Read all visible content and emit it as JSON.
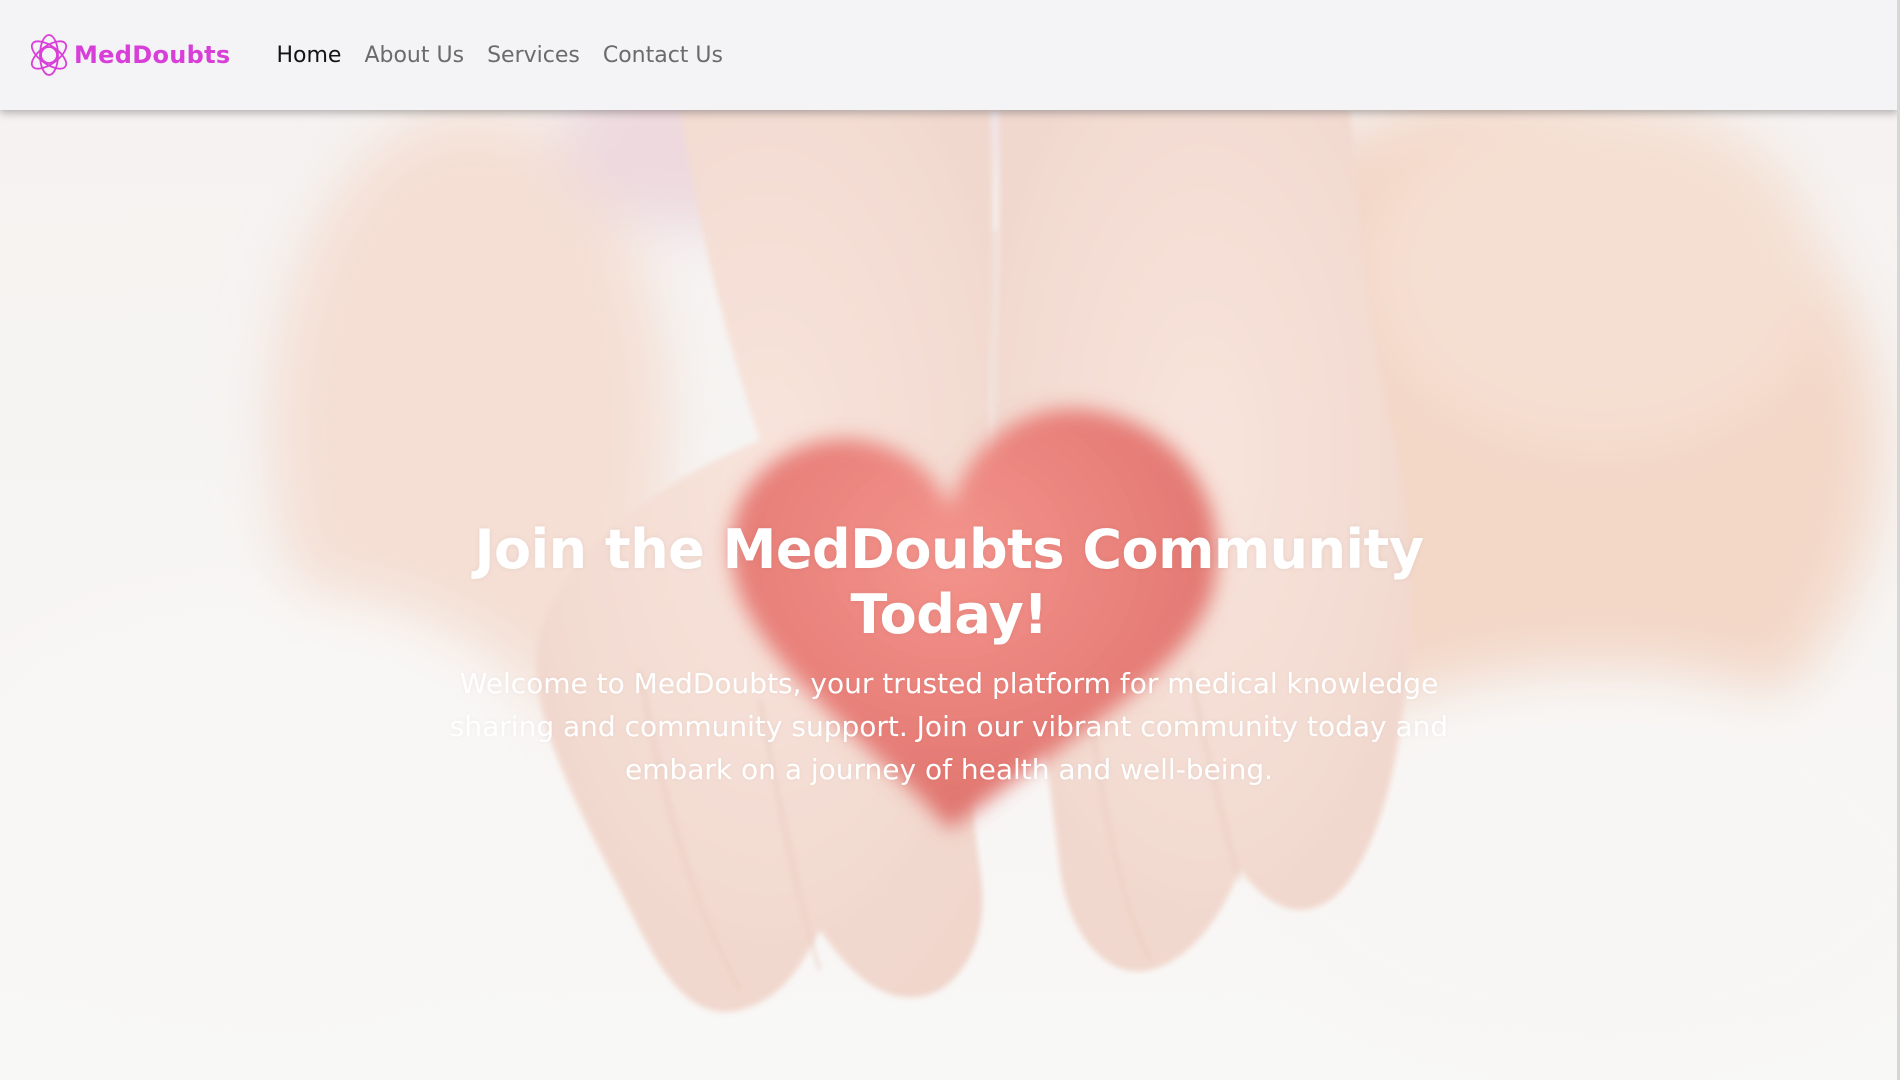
{
  "brand": {
    "name": "MedDoubts",
    "color": "#d83fd8",
    "logo_icon": "orbit-ring-logo-icon"
  },
  "nav": {
    "items": [
      {
        "label": "Home",
        "active": true
      },
      {
        "label": "About Us",
        "active": false
      },
      {
        "label": "Services",
        "active": false
      },
      {
        "label": "Contact Us",
        "active": false
      }
    ]
  },
  "hero": {
    "title": "Join the MedDoubts Community Today!",
    "text": "Welcome to MedDoubts, your trusted platform for medical knowledge sharing and community support. Join our vibrant community today and embark on a journey of health and well-being.",
    "background_image": "hands-holding-red-felt-heart-photo",
    "text_color": "#ffffff"
  }
}
